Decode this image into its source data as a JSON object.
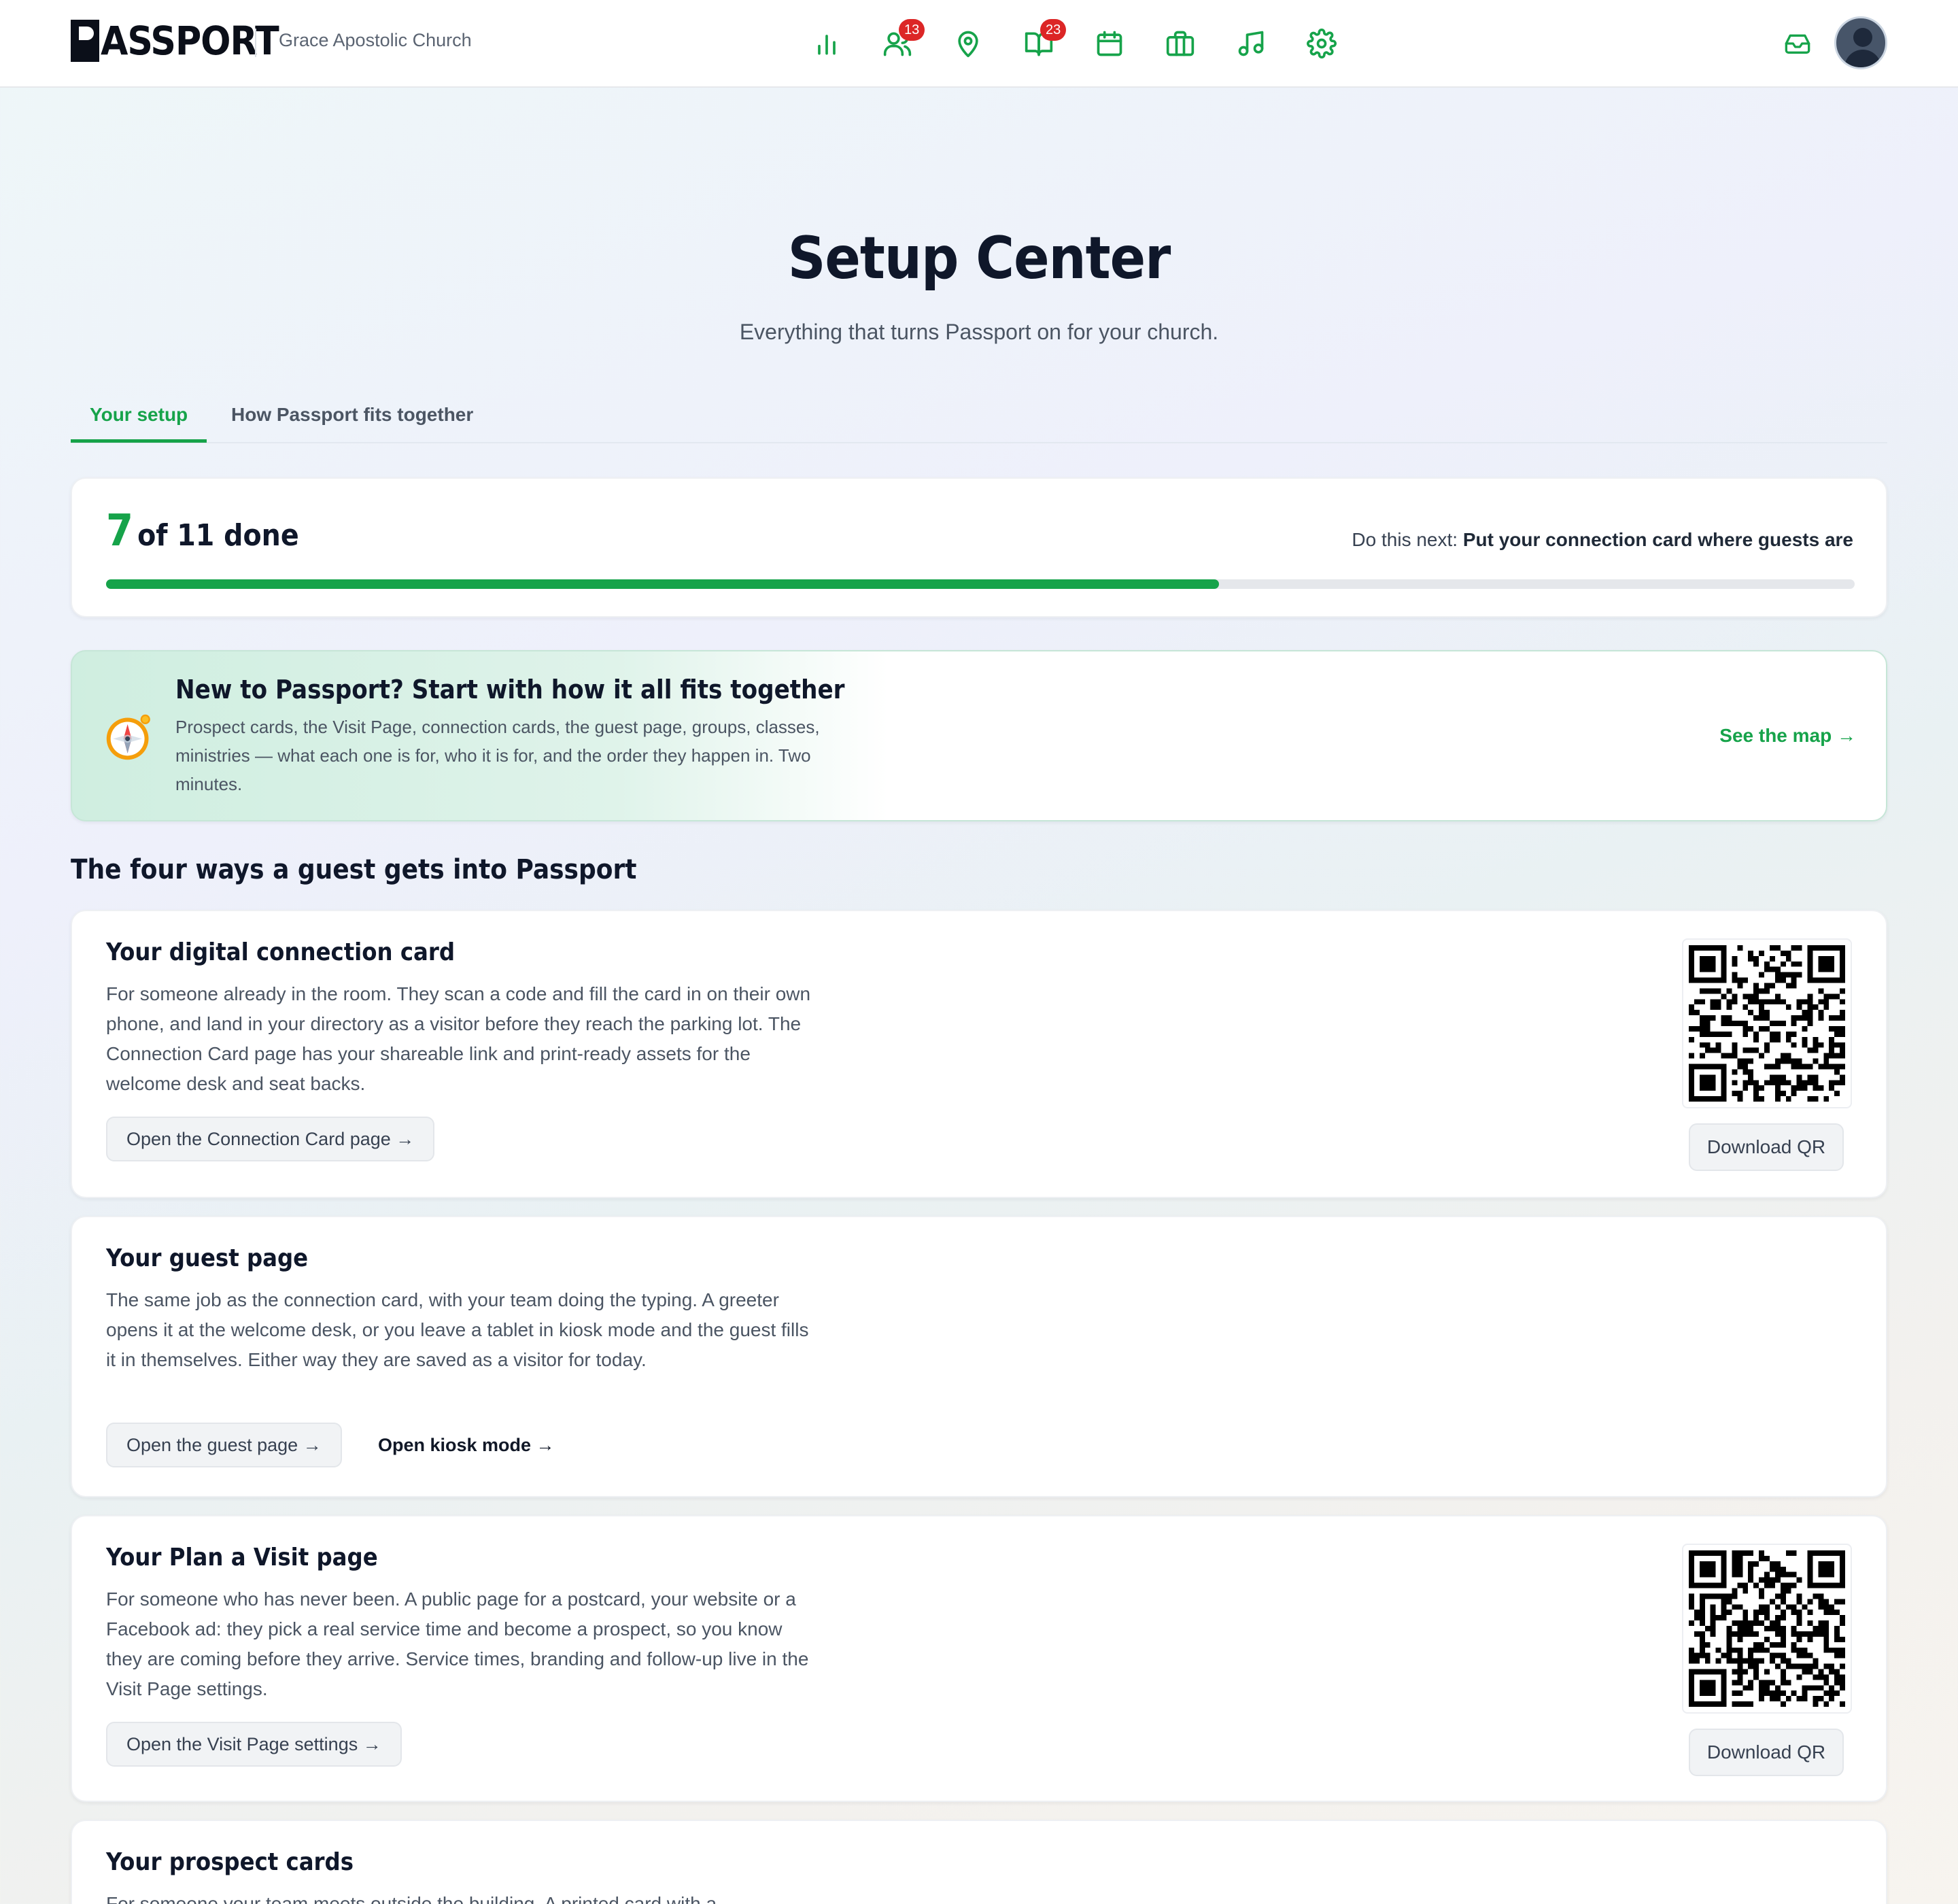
{
  "header": {
    "logo_text": "ASSPORT",
    "church_name": "Grace Apostolic Church",
    "nav": [
      {
        "icon": "bar-chart-icon",
        "badge": ""
      },
      {
        "icon": "people-icon",
        "badge": "13"
      },
      {
        "icon": "map-pin-icon",
        "badge": ""
      },
      {
        "icon": "book-open-icon",
        "badge": "23"
      },
      {
        "icon": "calendar-icon",
        "badge": ""
      },
      {
        "icon": "briefcase-icon",
        "badge": ""
      },
      {
        "icon": "music-note-icon",
        "badge": ""
      },
      {
        "icon": "gear-icon",
        "badge": ""
      }
    ],
    "accent_color": "#16a34a",
    "badge_color": "#dc2626"
  },
  "hero": {
    "title": "Setup Center",
    "subtitle": "Everything that turns Passport on for your church."
  },
  "tabs": [
    {
      "label": "Your setup",
      "active": true
    },
    {
      "label": "How Passport fits together",
      "active": false
    }
  ],
  "progress": {
    "done": "7",
    "rest": "of 11 done",
    "completed": 7,
    "total": 11,
    "next_label": "Do this next:",
    "next_task": "Put your connection card where guests are"
  },
  "intro": {
    "title": "New to Passport? Start with how it all fits together",
    "body": "Prospect cards, the Visit Page, connection cards, the guest page, groups, classes, ministries — what each one is for, who it is for, and the order they happen in. Two minutes.",
    "link": "See the map →"
  },
  "section_heading": "The four ways a guest gets into Passport",
  "cards": {
    "connection": {
      "title": "Your digital connection card",
      "body": "For someone already in the room. They scan a code and fill the card in on their own phone, and land in your directory as a visitor before they reach the parking lot. The Connection Card page has your shareable link and print-ready assets for the welcome desk and seat backs.",
      "button": "Open the Connection Card page →",
      "qr_button": "Download QR"
    },
    "guest": {
      "title": "Your guest page",
      "body": "The same job as the connection card, with your team doing the typing. A greeter opens it at the welcome desk, or you leave a tablet in kiosk mode and the guest fills it in themselves. Either way they are saved as a visitor for today.",
      "button": "Open the guest page →",
      "link": "Open kiosk mode →"
    },
    "visit": {
      "title": "Your Plan a Visit page",
      "body": "For someone who has never been. A public page for a postcard, your website or a Facebook ad: they pick a real service time and become a prospect, so you know they are coming before they arrive. Service times, branding and follow-up live in the Visit Page settings.",
      "button": "Open the Visit Page settings →",
      "qr_button": "Download QR"
    },
    "prospect": {
      "title": "Your prospect cards",
      "body": "For someone your team meets outside the building. A printed card with a"
    }
  }
}
